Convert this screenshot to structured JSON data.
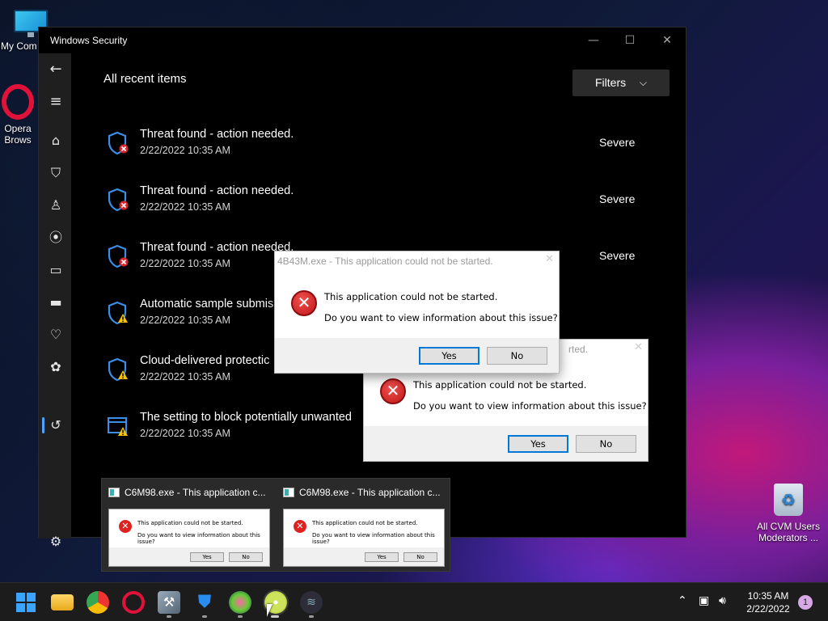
{
  "desktop": {
    "icons": [
      {
        "label": "My Com"
      },
      {
        "label": "Opera",
        "label2": "Brows"
      },
      {
        "label": "All CVM Users",
        "label2": "Moderators ..."
      }
    ]
  },
  "window": {
    "title": "Windows Security",
    "page_title": "All recent items",
    "filters_label": "Filters",
    "items": [
      {
        "title": "Threat found - action needed.",
        "date": "2/22/2022 10:35 AM",
        "severity": "Severe",
        "icon": "shield-threat-icon"
      },
      {
        "title": "Threat found - action needed.",
        "date": "2/22/2022 10:35 AM",
        "severity": "Severe",
        "icon": "shield-threat-icon"
      },
      {
        "title": "Threat found - action needed.",
        "date": "2/22/2022 10:35 AM",
        "severity": "Severe",
        "icon": "shield-threat-icon"
      },
      {
        "title": "Automatic sample submis",
        "date": "2/22/2022 10:35 AM",
        "severity": "",
        "icon": "shield-warning-icon"
      },
      {
        "title": "Cloud-delivered protectic",
        "date": "2/22/2022 10:35 AM",
        "severity": "",
        "icon": "shield-warning-icon"
      },
      {
        "title": "The setting to block potentially unwanted",
        "date": "2/22/2022 10:35 AM",
        "severity": "",
        "icon": "app-warning-icon"
      }
    ]
  },
  "dialogs": [
    {
      "title": "4B43M.exe - This application could not be started.",
      "line1": "This application could not be started.",
      "line2": "Do you want to view information about this issue?",
      "yes": "Yes",
      "no": "No"
    },
    {
      "title": "rted.",
      "line1": "This application could not be started.",
      "line2": "Do you want to view information about this issue?",
      "yes": "Yes",
      "no": "No"
    }
  ],
  "previews": [
    {
      "title": "C6M98.exe - This application c...",
      "line1": "This application could not be started.",
      "line2": "Do you want to view information about this issue?",
      "yes": "Yes",
      "no": "No"
    },
    {
      "title": "C6M98.exe - This application c...",
      "line1": "This application could not be started.",
      "line2": "Do you want to view information about this issue?",
      "yes": "Yes",
      "no": "No"
    }
  ],
  "taskbar": {
    "time": "10:35 AM",
    "date": "2/22/2022",
    "notifications": "1"
  },
  "colors": {
    "accent": "#4ca3ff",
    "error_red": "#c01818",
    "warning_yellow": "#f5c400"
  }
}
